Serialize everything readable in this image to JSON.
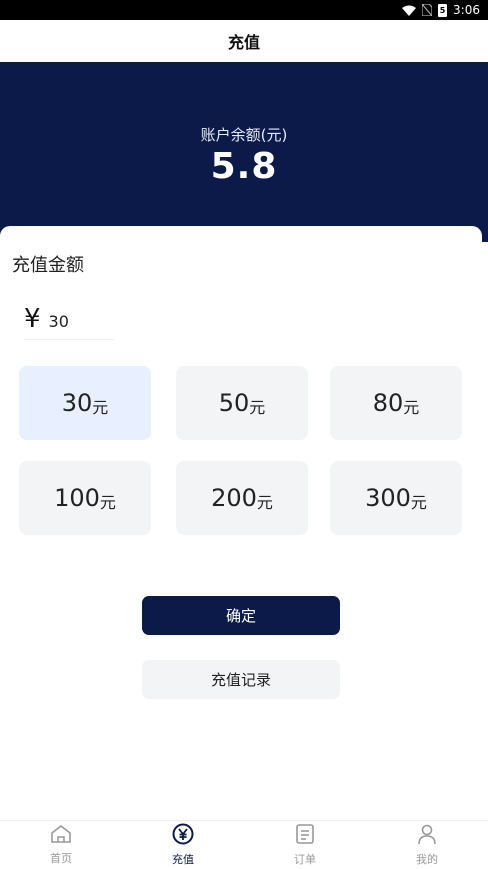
{
  "status_bar": {
    "time": "3:06",
    "battery_text": "5"
  },
  "header": {
    "title": "充值"
  },
  "balance": {
    "label": "账户余额(元)",
    "value": "5.8"
  },
  "recharge": {
    "section_title": "充值金额",
    "currency_symbol": "¥",
    "amount_value": "30",
    "unit": "元",
    "options": [
      {
        "amount": "30",
        "selected": true
      },
      {
        "amount": "50",
        "selected": false
      },
      {
        "amount": "80",
        "selected": false
      },
      {
        "amount": "100",
        "selected": false
      },
      {
        "amount": "200",
        "selected": false
      },
      {
        "amount": "300",
        "selected": false
      }
    ],
    "confirm_label": "确定",
    "history_label": "充值记录"
  },
  "tabbar": {
    "items": [
      {
        "label": "首页",
        "icon": "home-icon",
        "active": false
      },
      {
        "label": "充值",
        "icon": "yen-circle-icon",
        "active": true
      },
      {
        "label": "订单",
        "icon": "order-list-icon",
        "active": false
      },
      {
        "label": "我的",
        "icon": "user-icon",
        "active": false
      }
    ]
  },
  "colors": {
    "primary": "#0b1a48",
    "option_bg": "#f3f4f6",
    "option_selected_bg": "#e8effe"
  }
}
